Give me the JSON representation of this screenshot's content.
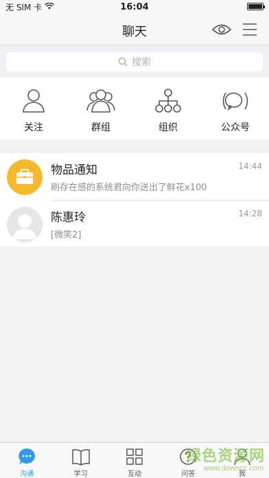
{
  "status_bar": {
    "carrier": "无 SIM 卡",
    "time": "16:04",
    "battery_level_pct": 100
  },
  "nav": {
    "title": "聊天",
    "icons": [
      "eye-icon",
      "menu-icon"
    ]
  },
  "search": {
    "placeholder": "搜索"
  },
  "quick_actions": [
    {
      "label": "关注",
      "icon": "person-icon"
    },
    {
      "label": "群组",
      "icon": "group-icon"
    },
    {
      "label": "组织",
      "icon": "org-chart-icon"
    },
    {
      "label": "公众号",
      "icon": "broadcast-icon"
    }
  ],
  "conversations": [
    {
      "title": "物品通知",
      "preview": "刷存在感的系统君向你送出了鲜花x100",
      "time": "14:44",
      "avatar": "briefcase-icon",
      "avatar_color": "#f6b92b"
    },
    {
      "title": "陈惠玲",
      "preview": "[微笑2]",
      "time": "14:28",
      "avatar": "default-avatar-icon",
      "avatar_color": "#e6e6e6"
    }
  ],
  "tabs": [
    {
      "label": "沟通",
      "icon": "chat-bubble-icon",
      "active": true
    },
    {
      "label": "学习",
      "icon": "book-icon",
      "active": false
    },
    {
      "label": "互动",
      "icon": "grid-icon",
      "active": false
    },
    {
      "label": "问答",
      "icon": "question-icon",
      "active": false
    },
    {
      "label": "我",
      "icon": "profile-icon",
      "active": false
    }
  ],
  "colors": {
    "accent": "#2f9be8",
    "notice_avatar": "#f6b92b"
  },
  "watermark": {
    "text": "绿色资源网",
    "url": "www.downcc.com"
  }
}
